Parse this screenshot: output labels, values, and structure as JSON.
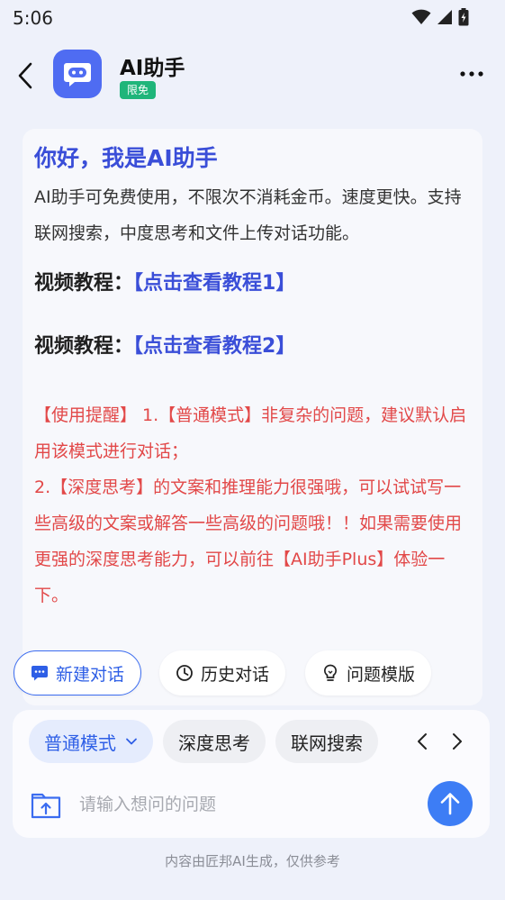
{
  "status_bar": {
    "time": "5:06"
  },
  "header": {
    "title": "AI助手",
    "badge": "限免"
  },
  "message": {
    "title": "你好，我是AI助手",
    "intro": "AI助手可免费使用，不限次不消耗金币。速度更快。支持联网搜索，中度思考和文件上传对话功能。",
    "tutorials": [
      {
        "label": "视频教程：",
        "link": "【点击查看教程1】"
      },
      {
        "label": "视频教程：",
        "link": "【点击查看教程2】"
      }
    ],
    "reminder_lines": [
      "【使用提醒】 1.【普通模式】非复杂的问题，建议默认启用该模式进行对话；",
      "2.【深度思考】的文案和推理能力很强哦，可以试试写一些高级的文案或解答一些高级的问题哦！！如果需要使用更强的深度思考能力，可以前往【AI助手Plus】体验一下。"
    ]
  },
  "quick_actions": [
    {
      "label": "新建对话",
      "icon": "chat-plus-icon"
    },
    {
      "label": "历史对话",
      "icon": "clock-icon"
    },
    {
      "label": "问题模版",
      "icon": "lightbulb-icon"
    }
  ],
  "modes": [
    {
      "label": "普通模式",
      "selected": true
    },
    {
      "label": "深度思考",
      "selected": false
    },
    {
      "label": "联网搜索",
      "selected": false
    }
  ],
  "input": {
    "placeholder": "请输入想问的问题",
    "value": ""
  },
  "footer": {
    "disclaimer": "内容由匠邦AI生成，仅供参考"
  },
  "colors": {
    "accent": "#3d7df5",
    "link": "#3a4ed8",
    "warning": "#e24848",
    "badge": "#1fb57a",
    "avatar": "#4f6cf2"
  }
}
